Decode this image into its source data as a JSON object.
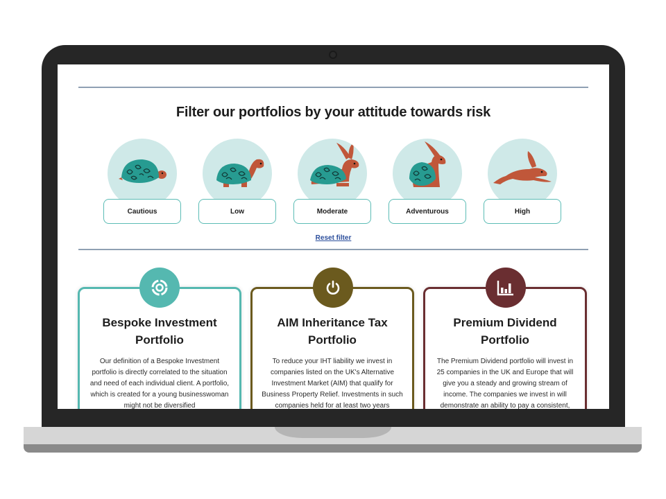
{
  "page": {
    "filter_title": "Filter our portfolios by your attitude towards risk",
    "reset_label": "Reset filter"
  },
  "risk_levels": [
    {
      "label": "Cautious",
      "icon": "tortoise-icon"
    },
    {
      "label": "Low",
      "icon": "tortoise-walking-icon"
    },
    {
      "label": "Moderate",
      "icon": "tortoise-hare-icon"
    },
    {
      "label": "Adventurous",
      "icon": "hare-shell-icon"
    },
    {
      "label": "High",
      "icon": "hare-running-icon"
    }
  ],
  "cards": [
    {
      "title": "Bespoke Investment Portfolio",
      "icon": "circular-chart-icon",
      "accent": "#55b8b0",
      "body": "Our definition of a Bespoke Investment portfolio is directly correlated to the situation and need of each individual client. A portfolio, which is created for a young businesswoman might not be diversified"
    },
    {
      "title": "AIM Inheritance Tax Portfolio",
      "icon": "power-icon",
      "accent": "#6b5a1e",
      "body": "To reduce your IHT liability we invest in companies listed on the UK's Alternative Investment Market (AIM) that qualify for Business Property Relief. Investments in such companies held for at least two years"
    },
    {
      "title": "Premium Dividend Portfolio",
      "icon": "bar-chart-icon",
      "accent": "#6a2e31",
      "body": "The Premium Dividend portfolio will invest in 25 companies in the UK and Europe that will give you a steady and growing stream of income. The companies we invest in will demonstrate an ability to pay a consistent,"
    }
  ],
  "colors": {
    "risk_circle": "#cfe9e8",
    "risk_button_border": "#5bbcb5",
    "shell": "#279b91",
    "animal": "#c0573a",
    "link": "#2a4d9b"
  }
}
